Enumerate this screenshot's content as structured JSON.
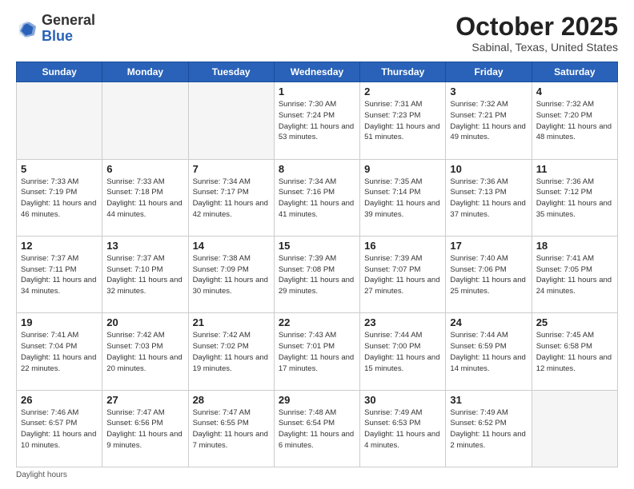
{
  "header": {
    "logo_general": "General",
    "logo_blue": "Blue",
    "month": "October 2025",
    "location": "Sabinal, Texas, United States"
  },
  "days_of_week": [
    "Sunday",
    "Monday",
    "Tuesday",
    "Wednesday",
    "Thursday",
    "Friday",
    "Saturday"
  ],
  "weeks": [
    [
      {
        "day": "",
        "info": ""
      },
      {
        "day": "",
        "info": ""
      },
      {
        "day": "",
        "info": ""
      },
      {
        "day": "1",
        "info": "Sunrise: 7:30 AM\nSunset: 7:24 PM\nDaylight: 11 hours\nand 53 minutes."
      },
      {
        "day": "2",
        "info": "Sunrise: 7:31 AM\nSunset: 7:23 PM\nDaylight: 11 hours\nand 51 minutes."
      },
      {
        "day": "3",
        "info": "Sunrise: 7:32 AM\nSunset: 7:21 PM\nDaylight: 11 hours\nand 49 minutes."
      },
      {
        "day": "4",
        "info": "Sunrise: 7:32 AM\nSunset: 7:20 PM\nDaylight: 11 hours\nand 48 minutes."
      }
    ],
    [
      {
        "day": "5",
        "info": "Sunrise: 7:33 AM\nSunset: 7:19 PM\nDaylight: 11 hours\nand 46 minutes."
      },
      {
        "day": "6",
        "info": "Sunrise: 7:33 AM\nSunset: 7:18 PM\nDaylight: 11 hours\nand 44 minutes."
      },
      {
        "day": "7",
        "info": "Sunrise: 7:34 AM\nSunset: 7:17 PM\nDaylight: 11 hours\nand 42 minutes."
      },
      {
        "day": "8",
        "info": "Sunrise: 7:34 AM\nSunset: 7:16 PM\nDaylight: 11 hours\nand 41 minutes."
      },
      {
        "day": "9",
        "info": "Sunrise: 7:35 AM\nSunset: 7:14 PM\nDaylight: 11 hours\nand 39 minutes."
      },
      {
        "day": "10",
        "info": "Sunrise: 7:36 AM\nSunset: 7:13 PM\nDaylight: 11 hours\nand 37 minutes."
      },
      {
        "day": "11",
        "info": "Sunrise: 7:36 AM\nSunset: 7:12 PM\nDaylight: 11 hours\nand 35 minutes."
      }
    ],
    [
      {
        "day": "12",
        "info": "Sunrise: 7:37 AM\nSunset: 7:11 PM\nDaylight: 11 hours\nand 34 minutes."
      },
      {
        "day": "13",
        "info": "Sunrise: 7:37 AM\nSunset: 7:10 PM\nDaylight: 11 hours\nand 32 minutes."
      },
      {
        "day": "14",
        "info": "Sunrise: 7:38 AM\nSunset: 7:09 PM\nDaylight: 11 hours\nand 30 minutes."
      },
      {
        "day": "15",
        "info": "Sunrise: 7:39 AM\nSunset: 7:08 PM\nDaylight: 11 hours\nand 29 minutes."
      },
      {
        "day": "16",
        "info": "Sunrise: 7:39 AM\nSunset: 7:07 PM\nDaylight: 11 hours\nand 27 minutes."
      },
      {
        "day": "17",
        "info": "Sunrise: 7:40 AM\nSunset: 7:06 PM\nDaylight: 11 hours\nand 25 minutes."
      },
      {
        "day": "18",
        "info": "Sunrise: 7:41 AM\nSunset: 7:05 PM\nDaylight: 11 hours\nand 24 minutes."
      }
    ],
    [
      {
        "day": "19",
        "info": "Sunrise: 7:41 AM\nSunset: 7:04 PM\nDaylight: 11 hours\nand 22 minutes."
      },
      {
        "day": "20",
        "info": "Sunrise: 7:42 AM\nSunset: 7:03 PM\nDaylight: 11 hours\nand 20 minutes."
      },
      {
        "day": "21",
        "info": "Sunrise: 7:42 AM\nSunset: 7:02 PM\nDaylight: 11 hours\nand 19 minutes."
      },
      {
        "day": "22",
        "info": "Sunrise: 7:43 AM\nSunset: 7:01 PM\nDaylight: 11 hours\nand 17 minutes."
      },
      {
        "day": "23",
        "info": "Sunrise: 7:44 AM\nSunset: 7:00 PM\nDaylight: 11 hours\nand 15 minutes."
      },
      {
        "day": "24",
        "info": "Sunrise: 7:44 AM\nSunset: 6:59 PM\nDaylight: 11 hours\nand 14 minutes."
      },
      {
        "day": "25",
        "info": "Sunrise: 7:45 AM\nSunset: 6:58 PM\nDaylight: 11 hours\nand 12 minutes."
      }
    ],
    [
      {
        "day": "26",
        "info": "Sunrise: 7:46 AM\nSunset: 6:57 PM\nDaylight: 11 hours\nand 10 minutes."
      },
      {
        "day": "27",
        "info": "Sunrise: 7:47 AM\nSunset: 6:56 PM\nDaylight: 11 hours\nand 9 minutes."
      },
      {
        "day": "28",
        "info": "Sunrise: 7:47 AM\nSunset: 6:55 PM\nDaylight: 11 hours\nand 7 minutes."
      },
      {
        "day": "29",
        "info": "Sunrise: 7:48 AM\nSunset: 6:54 PM\nDaylight: 11 hours\nand 6 minutes."
      },
      {
        "day": "30",
        "info": "Sunrise: 7:49 AM\nSunset: 6:53 PM\nDaylight: 11 hours\nand 4 minutes."
      },
      {
        "day": "31",
        "info": "Sunrise: 7:49 AM\nSunset: 6:52 PM\nDaylight: 11 hours\nand 2 minutes."
      },
      {
        "day": "",
        "info": ""
      }
    ]
  ],
  "footer": {
    "note": "Daylight hours"
  }
}
